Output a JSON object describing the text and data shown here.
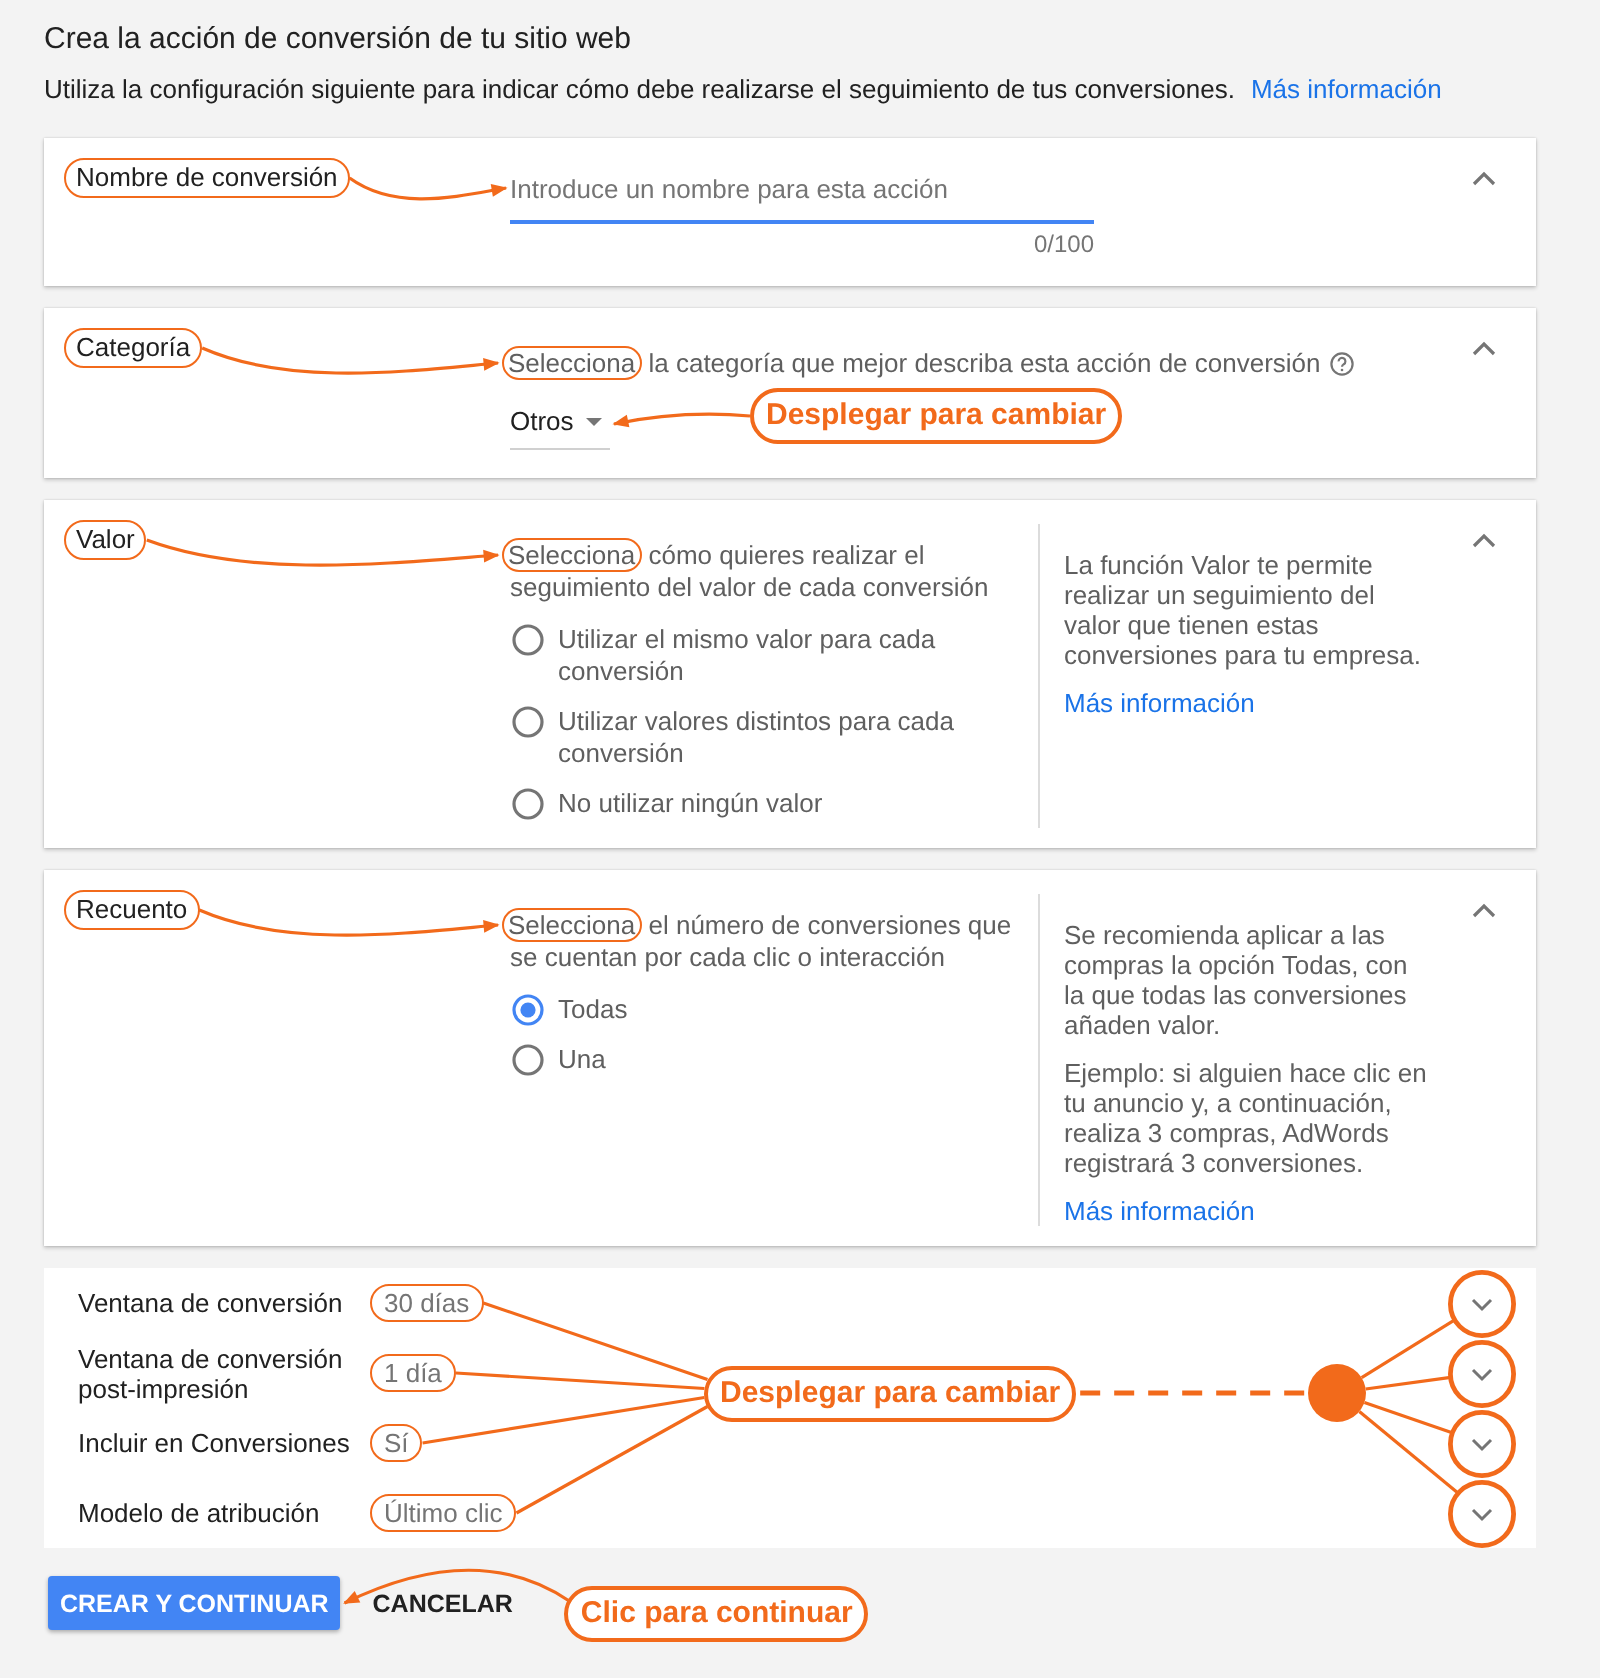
{
  "header": {
    "title": "Crea la acción de conversión de tu sitio web",
    "description": "Utiliza la configuración siguiente para indicar cómo debe realizarse el seguimiento de tus conversiones.",
    "link": "Más información"
  },
  "sections": [
    {
      "kind": "input",
      "label": "Nombre de conversión",
      "marked": true,
      "expanded": true,
      "field": {
        "placeholder": "Introduce un nombre para esta acción",
        "focused": true,
        "counter": "0/100"
      }
    },
    {
      "kind": "dropdown",
      "label": "Categoría",
      "marked": true,
      "expanded": true,
      "prompt_marked": "Selecciona",
      "prompt": "la categoría que mejor describa esta acción de conversión",
      "help_icon": true,
      "dropdown": {
        "value": "Otros"
      },
      "callout": "Desplegar para cambiar"
    },
    {
      "kind": "radio",
      "label": "Valor",
      "marked": true,
      "expanded": true,
      "prompt_marked": "Selecciona",
      "prompt": "cómo quieres realizar el seguimiento del valor de cada conversión",
      "options": [
        {
          "label": "Utilizar el mismo valor para cada conversión",
          "selected": false
        },
        {
          "label": "Utilizar valores distintos para cada conversión",
          "selected": false
        },
        {
          "label": "No utilizar ningún valor",
          "selected": false
        }
      ],
      "help": [
        "La función Valor te permite realizar un seguimiento del valor que tienen estas conversiones para tu empresa."
      ],
      "help_link": "Más información"
    },
    {
      "kind": "radio",
      "label": "Recuento",
      "marked": true,
      "expanded": true,
      "prompt_marked": "Selecciona",
      "prompt": "el número de conversiones que se cuentan por cada clic o interacción",
      "options": [
        {
          "label": "Todas",
          "selected": true
        },
        {
          "label": "Una",
          "selected": false
        }
      ],
      "help": [
        "Se recomienda aplicar a las compras la opción Todas, con la que todas las conversiones añaden valor.",
        "Ejemplo: si alguien hace clic en tu anuncio y, a continuación, realiza 3 compras, AdWords registrará 3 conversiones."
      ],
      "help_link": "Más información"
    }
  ],
  "settings": {
    "callout": "Desplegar para cambiar",
    "rows": [
      {
        "label": "Ventana de conversión",
        "value": "30 días",
        "marked": true,
        "expanded": false
      },
      {
        "label": "Ventana de conversión post-impresión",
        "value": "1 día",
        "marked": true,
        "expanded": false
      },
      {
        "label": "Incluir en Conversiones",
        "value": "Sí",
        "marked": true,
        "expanded": false
      },
      {
        "label": "Modelo de atribución",
        "value": "Último clic",
        "marked": true,
        "expanded": false
      }
    ]
  },
  "actions": {
    "primary": "CREAR Y CONTINUAR",
    "secondary": "CANCELAR",
    "callout": "Clic para continuar"
  }
}
